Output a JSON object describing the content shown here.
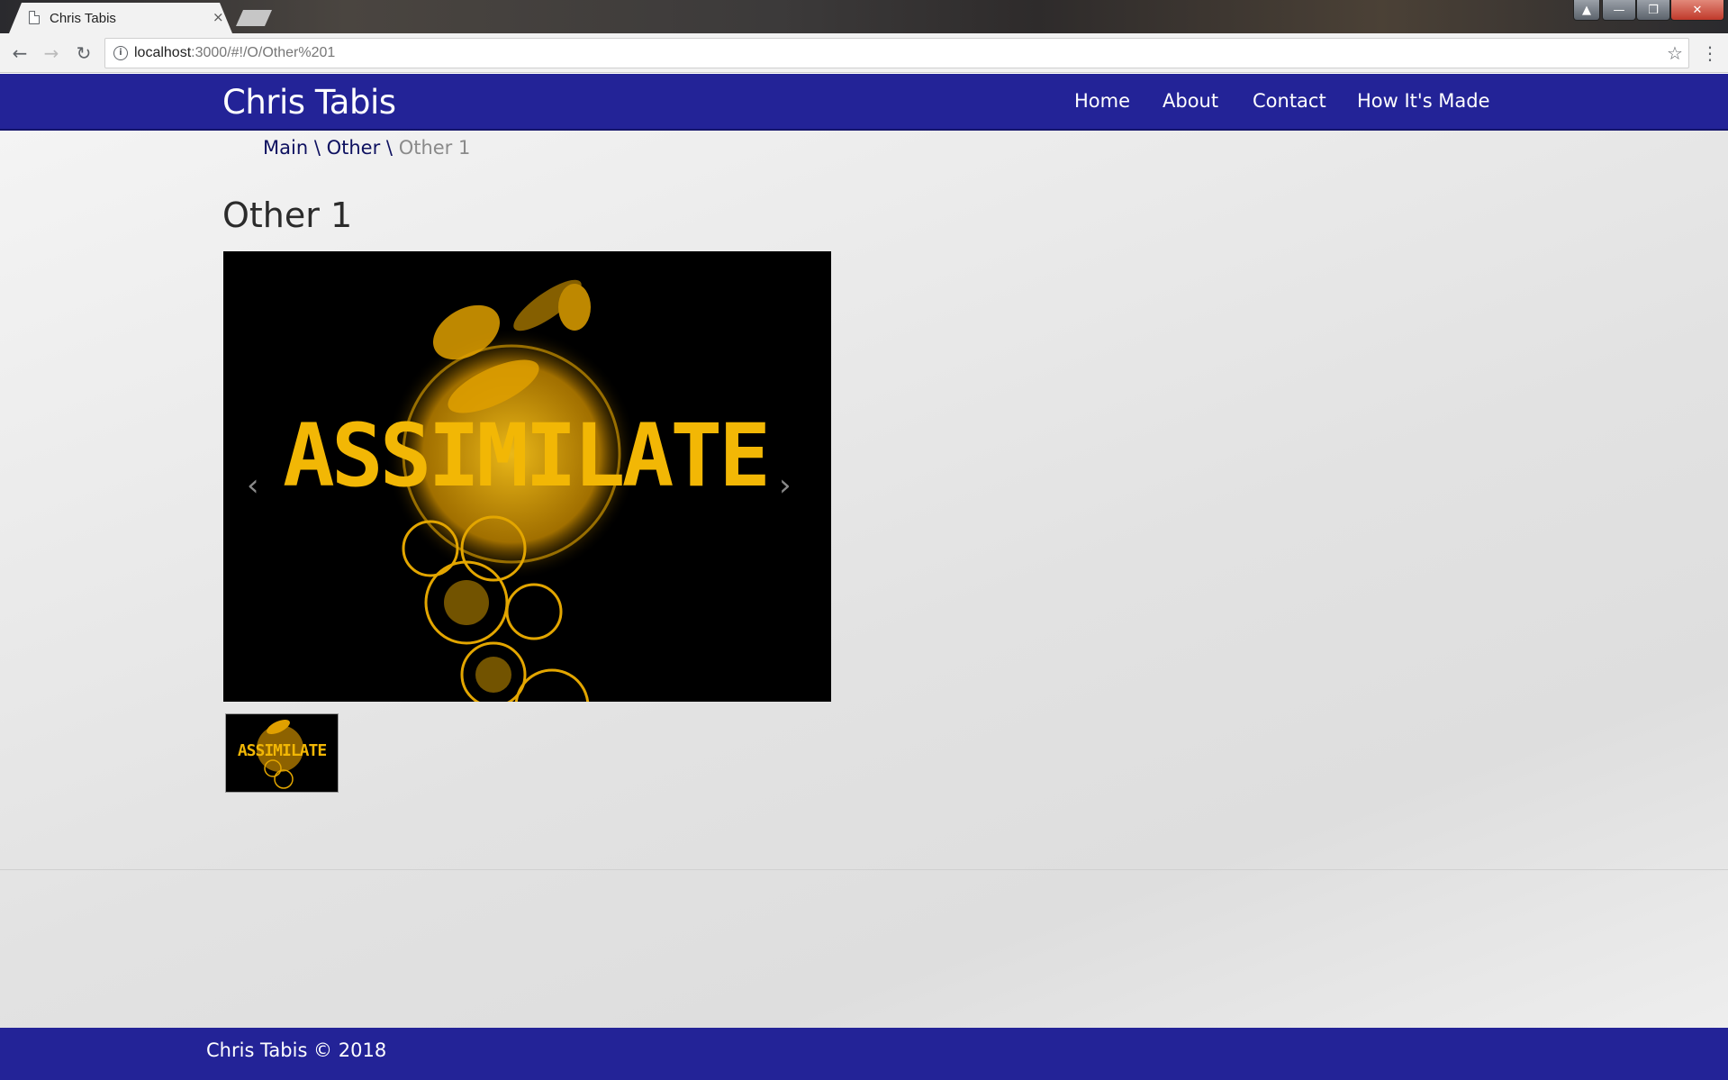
{
  "browser": {
    "tab_title": "Chris Tabis",
    "tab_close": "×",
    "url_host": "localhost",
    "url_path": ":3000/#!/O/Other%201",
    "window_close": "✕"
  },
  "site": {
    "brand": "Chris Tabis",
    "nav": [
      "Home",
      "About",
      "Contact",
      "How It's Made"
    ]
  },
  "breadcrumb": {
    "items": [
      "Main",
      "Other"
    ],
    "separator": "\\",
    "current": "Other 1"
  },
  "page": {
    "heading": "Other 1"
  },
  "carousel": {
    "image_text": "ASSIMILATE",
    "prev": "‹",
    "next": "›"
  },
  "thumbnail": {
    "image_text": "ASSIMILATE"
  },
  "footer": {
    "text": "Chris Tabis © 2018"
  },
  "colors": {
    "navbar": "#232397",
    "image_accent": "#f2b705",
    "breadcrumb_link": "#0e1160"
  }
}
